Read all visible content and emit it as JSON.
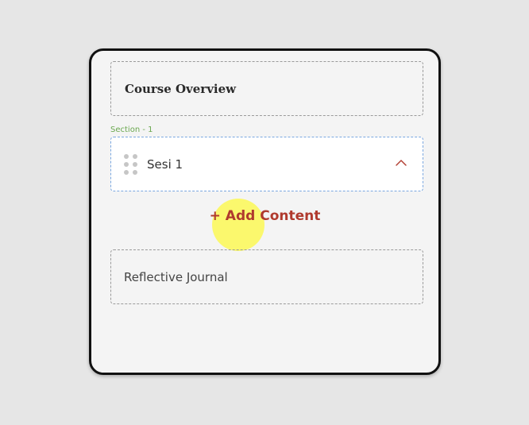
{
  "overview": {
    "title": "Course Overview"
  },
  "section": {
    "label": "Section - 1"
  },
  "session": {
    "name": "Sesi 1"
  },
  "add_content": {
    "label": "+ Add Content"
  },
  "content_items": [
    {
      "title": "Reflective Journal"
    }
  ],
  "icons": {
    "drag": "drag-handle-icon",
    "collapse": "chevron-up-icon"
  },
  "colors": {
    "accent": "#b03a2e",
    "section_label": "#6aa84f",
    "tap_highlight": "#fcf846",
    "session_border": "#7aa7e0"
  }
}
